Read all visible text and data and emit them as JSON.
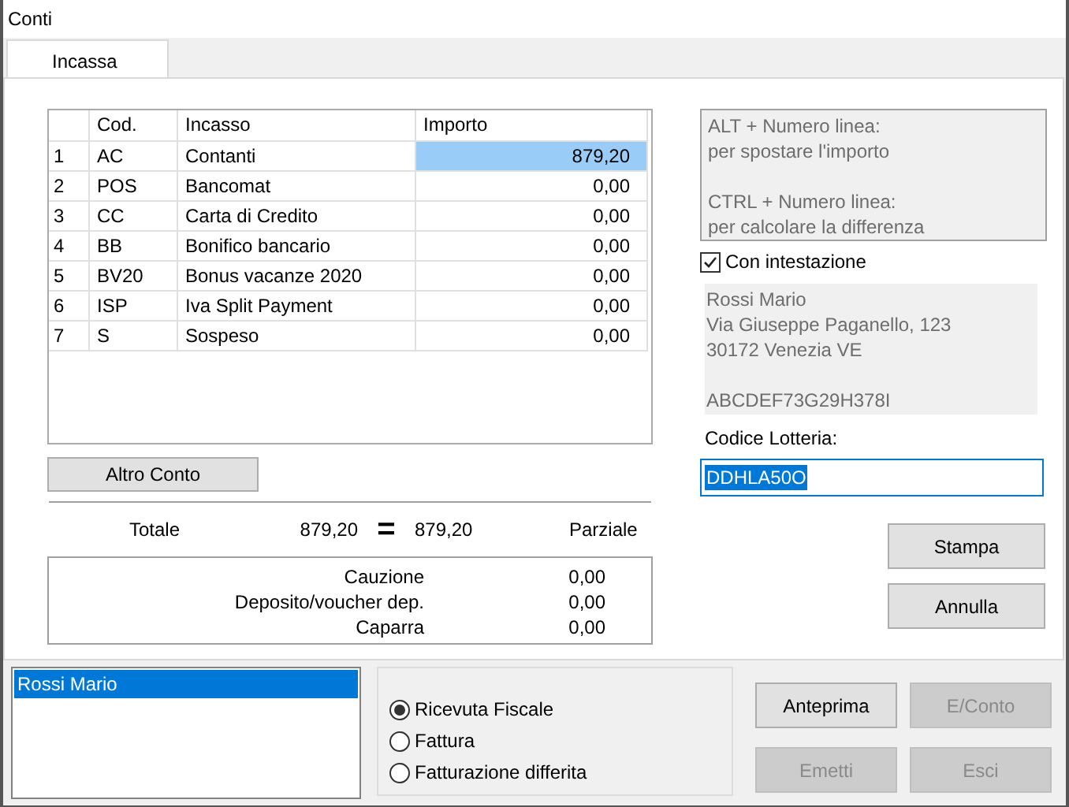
{
  "window": {
    "title": "Conti"
  },
  "tabs": [
    {
      "label": "Incassa",
      "selected": true
    }
  ],
  "table": {
    "columns": [
      "",
      "Cod.",
      "Incasso",
      "Importo"
    ],
    "rows": [
      {
        "cells": [
          "1",
          "AC",
          "Contanti",
          "879,20"
        ],
        "selected": true
      },
      {
        "cells": [
          "2",
          "POS",
          "Bancomat",
          "0,00"
        ],
        "selected": false
      },
      {
        "cells": [
          "3",
          "CC",
          "Carta di Credito",
          "0,00"
        ],
        "selected": false
      },
      {
        "cells": [
          "4",
          "BB",
          "Bonifico bancario",
          "0,00"
        ],
        "selected": false
      },
      {
        "cells": [
          "5",
          "BV20",
          "Bonus vacanze 2020",
          "0,00"
        ],
        "selected": false
      },
      {
        "cells": [
          "6",
          "ISP",
          "Iva Split Payment",
          "0,00"
        ],
        "selected": false
      },
      {
        "cells": [
          "7",
          "S",
          "Sospeso",
          "0,00"
        ],
        "selected": false
      }
    ]
  },
  "altro_conto_button": "Altro Conto",
  "totals": {
    "label": "Totale",
    "total": "879,20",
    "equals_sign": "=",
    "partial": "879,20",
    "partial_label": "Parziale"
  },
  "deposits": [
    {
      "label": "Cauzione",
      "value": "0,00"
    },
    {
      "label": "Deposito/voucher dep.",
      "value": "0,00"
    },
    {
      "label": "Caparra",
      "value": "0,00"
    }
  ],
  "hint_paragraphs": [
    [
      "ALT + Numero linea:",
      "per spostare l'importo"
    ],
    [
      "CTRL + Numero linea:",
      "per calcolare la differenza"
    ]
  ],
  "con_intestazione": {
    "label": "Con intestazione",
    "checked": true
  },
  "address_paragraphs": [
    [
      "Rossi Mario",
      "Via Giuseppe Paganello, 123",
      "30172 Venezia VE"
    ],
    [
      "ABCDEF73G29H378I"
    ]
  ],
  "codice_lotteria": {
    "label": "Codice Lotteria:",
    "value": "DDHLA50O"
  },
  "side_buttons": [
    {
      "label": "Stampa",
      "disabled": false
    },
    {
      "label": "Annulla",
      "disabled": false
    }
  ],
  "customers": [
    {
      "label": "Rossi Mario",
      "selected": true
    }
  ],
  "document_types": [
    {
      "label": "Ricevuta Fiscale",
      "selected": true
    },
    {
      "label": "Fattura",
      "selected": false
    },
    {
      "label": "Fatturazione differita",
      "selected": false
    }
  ],
  "bottom_buttons": [
    {
      "label": "Anteprima",
      "disabled": false
    },
    {
      "label": "E/Conto",
      "disabled": true
    },
    {
      "label": "Emetti",
      "disabled": true
    },
    {
      "label": "Esci",
      "disabled": true
    }
  ]
}
